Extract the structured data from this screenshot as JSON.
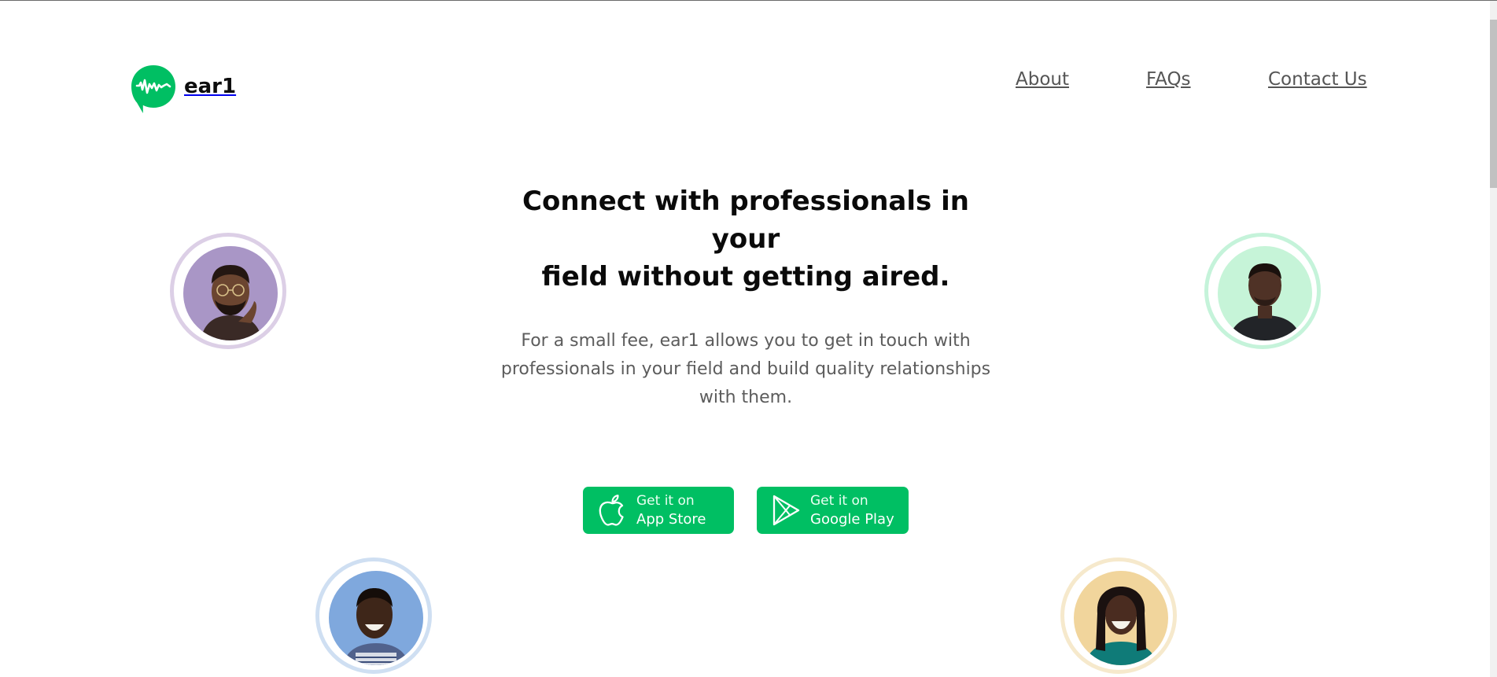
{
  "brand": {
    "name": "ear1",
    "accent_color": "#00bf63",
    "logo_icon": "chat-bubble-soundwave-icon"
  },
  "nav": {
    "items": [
      {
        "label": "About"
      },
      {
        "label": "FAQs"
      },
      {
        "label": "Contact Us"
      }
    ]
  },
  "hero": {
    "headline_line1": "Connect with professionals in your",
    "headline_line2": "field without getting aired.",
    "subtext_line1": "For a small fee, ear1 allows you to get in touch with",
    "subtext_line2": "professionals in your field and build quality relationships",
    "subtext_line3": "with them."
  },
  "downloads": {
    "app_store": {
      "line1": "Get it on",
      "line2": "App Store",
      "icon": "apple-icon"
    },
    "google_play": {
      "line1": "Get it on",
      "line2": "Google Play",
      "icon": "play-store-icon"
    }
  },
  "avatars": [
    {
      "position": "top-left",
      "ring_color": "#dccfe6",
      "bg_color": "#a996c6"
    },
    {
      "position": "top-right",
      "ring_color": "#c5f3da",
      "bg_color": "#c6f4d8"
    },
    {
      "position": "bottom-left",
      "ring_color": "#cfdff2",
      "bg_color": "#7fa8dd"
    },
    {
      "position": "bottom-right",
      "ring_color": "#f6e9cc",
      "bg_color": "#f1d59c"
    }
  ]
}
